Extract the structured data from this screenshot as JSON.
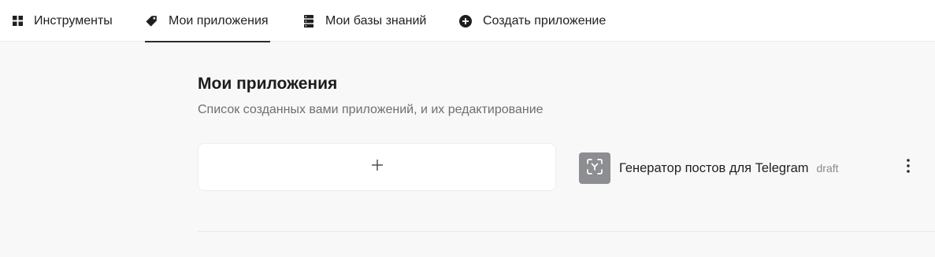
{
  "nav": {
    "tabs": [
      {
        "label": "Инструменты",
        "icon": "grid-icon",
        "active": false
      },
      {
        "label": "Мои приложения",
        "icon": "tag-icon",
        "active": true
      },
      {
        "label": "Мои базы знаний",
        "icon": "database-icon",
        "active": false
      },
      {
        "label": "Создать приложение",
        "icon": "plus-circle-icon",
        "active": false
      }
    ]
  },
  "main": {
    "title": "Мои приложения",
    "subtitle": "Список созданных вами приложений, и их редактирование",
    "add_card": {
      "icon": "plus-icon"
    },
    "apps": [
      {
        "name": "Генератор постов для Telegram",
        "status": "draft",
        "icon": "ai-scan-icon"
      }
    ]
  },
  "colors": {
    "active_underline": "#2b2b2b",
    "app_icon_bg": "#8c8e91",
    "page_bg": "#f8f8f8"
  }
}
